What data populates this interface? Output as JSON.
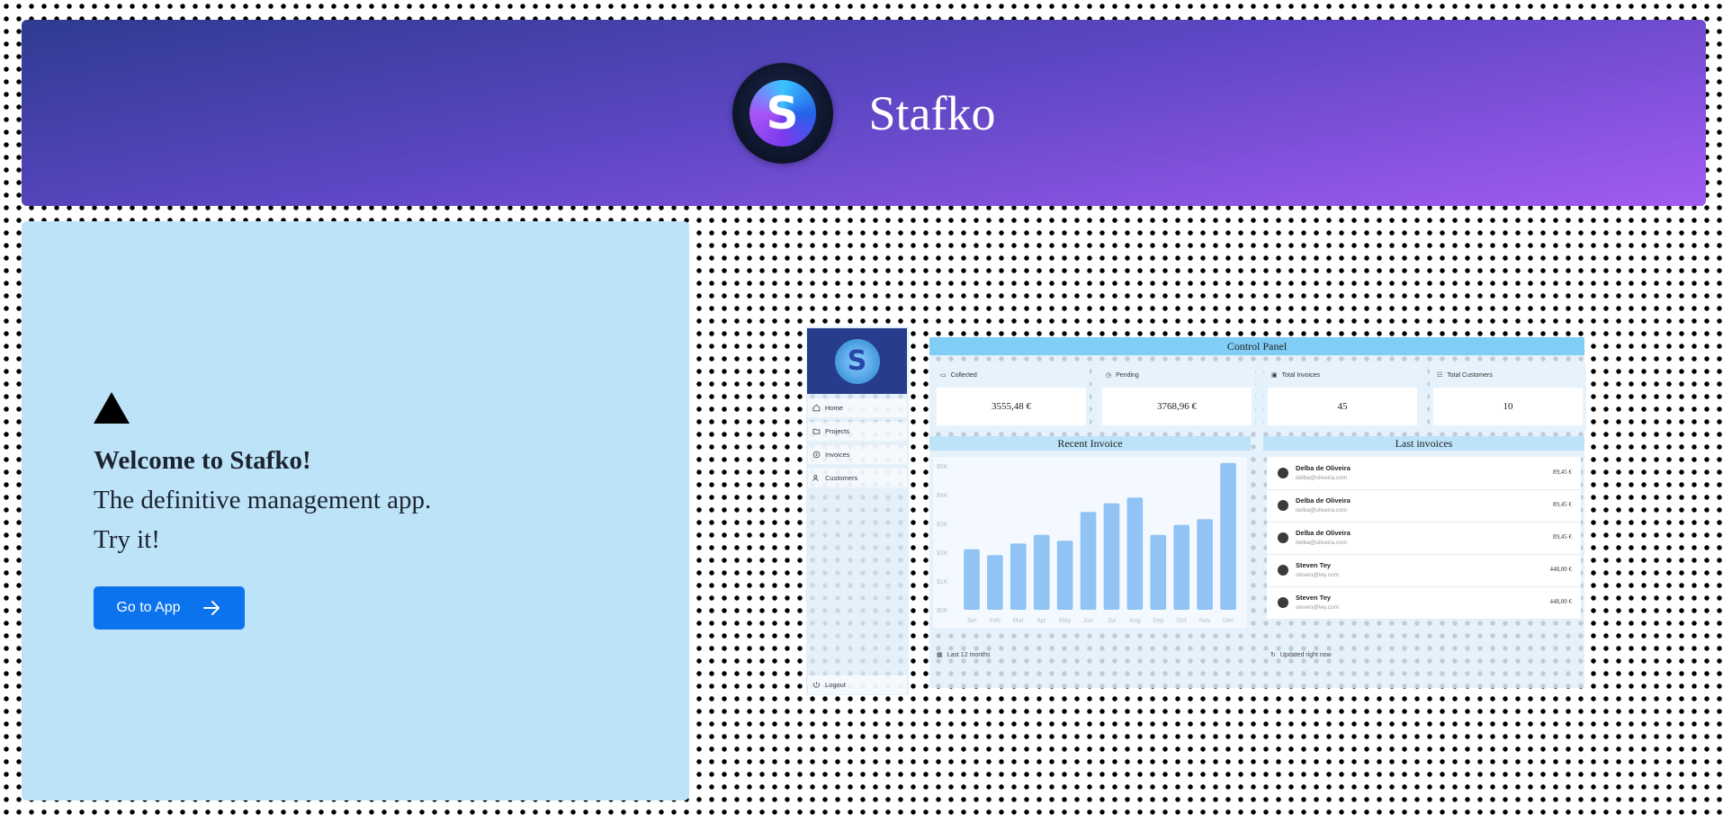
{
  "header": {
    "brand": "Stafko",
    "logo_letter": "S",
    "logo_icon": "stafko-logo-icon"
  },
  "welcome": {
    "icon": "triangle-icon",
    "title": "Welcome to Stafko!",
    "subtitle": "The definitive management app.",
    "cta_text": "Try it!",
    "button_label": "Go to App",
    "button_icon": "arrow-right-icon"
  },
  "preview": {
    "logo_letter": "S",
    "nav": [
      "Home",
      "Projects",
      "Invoices",
      "Customers"
    ],
    "logout": "Logout",
    "title": "Control Panel",
    "cards": [
      {
        "label": "Collected",
        "value": "3555,48 €",
        "icon": "banknote-icon"
      },
      {
        "label": "Pending",
        "value": "3768,96 €",
        "icon": "clock-icon"
      },
      {
        "label": "Total Invoices",
        "value": "45",
        "icon": "inbox-icon"
      },
      {
        "label": "Total Customers",
        "value": "10",
        "icon": "users-icon"
      }
    ],
    "recent_title": "Recent Invoice",
    "chart_footer": "Last 12 months",
    "last_title": "Last invoices",
    "list_footer": "Updated right now",
    "invoices": [
      {
        "name": "Delba de Oliveira",
        "email": "delba@oliveira.com",
        "amount": "89,45 €"
      },
      {
        "name": "Delba de Oliveira",
        "email": "delba@oliveira.com",
        "amount": "89,45 €"
      },
      {
        "name": "Delba de Oliveira",
        "email": "delba@oliveira.com",
        "amount": "89,45 €"
      },
      {
        "name": "Steven Tey",
        "email": "steven@tey.com",
        "amount": "448,00 €"
      },
      {
        "name": "Steven Tey",
        "email": "steven@tey.com",
        "amount": "448,00 €"
      }
    ]
  },
  "chart_data": {
    "type": "bar",
    "categories": [
      "Jan",
      "Feb",
      "Mar",
      "Apr",
      "May",
      "Jun",
      "Jul",
      "Aug",
      "Sep",
      "Oct",
      "Nov",
      "Dec"
    ],
    "values": [
      2100,
      1900,
      2300,
      2600,
      2400,
      3400,
      3700,
      3900,
      2600,
      2950,
      3150,
      5100
    ],
    "ylim": [
      0,
      5000
    ],
    "yticks": [
      "$0K",
      "$1K",
      "$2K",
      "$3K",
      "$4K",
      "$5K"
    ],
    "color": "#91c3f5",
    "grid": false
  }
}
